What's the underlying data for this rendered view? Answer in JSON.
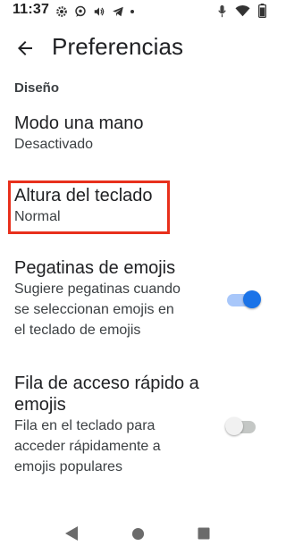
{
  "status_bar": {
    "time": "11:37",
    "left_icons": [
      "settings-icon",
      "whatsapp-icon",
      "volume-icon",
      "telegram-icon",
      "notification-dot"
    ],
    "right_icons": [
      "mic-icon",
      "wifi-icon",
      "battery-icon"
    ]
  },
  "app_bar": {
    "title": "Preferencias",
    "back_icon": "arrow-back-icon"
  },
  "section": {
    "header": "Diseño"
  },
  "prefs": {
    "one_hand": {
      "title": "Modo una mano",
      "summary": "Desactivado"
    },
    "height": {
      "title": "Altura del teclado",
      "summary": "Normal"
    },
    "emoji_stickers": {
      "title": "Pegatinas de emojis",
      "summary_lines": [
        "Sugiere pegatinas cuando",
        "se seleccionan emojis en",
        "el teclado de emojis"
      ],
      "enabled": true
    },
    "emoji_row": {
      "title_lines": [
        "Fila de acceso rápido a",
        "emojis"
      ],
      "summary_lines": [
        "Fila en el teclado para",
        "acceder rápidamente a",
        "emojis populares"
      ],
      "enabled": false
    }
  },
  "colors": {
    "accent": "#1a73e8",
    "accent_track": "#a8c7fa",
    "highlight_border": "#e8301c",
    "off_thumb": "#f1f1f1",
    "off_track": "#c4c7c5"
  },
  "nav_bar": {
    "icons": [
      "back-triangle-icon",
      "home-circle-icon",
      "recents-square-icon"
    ]
  }
}
